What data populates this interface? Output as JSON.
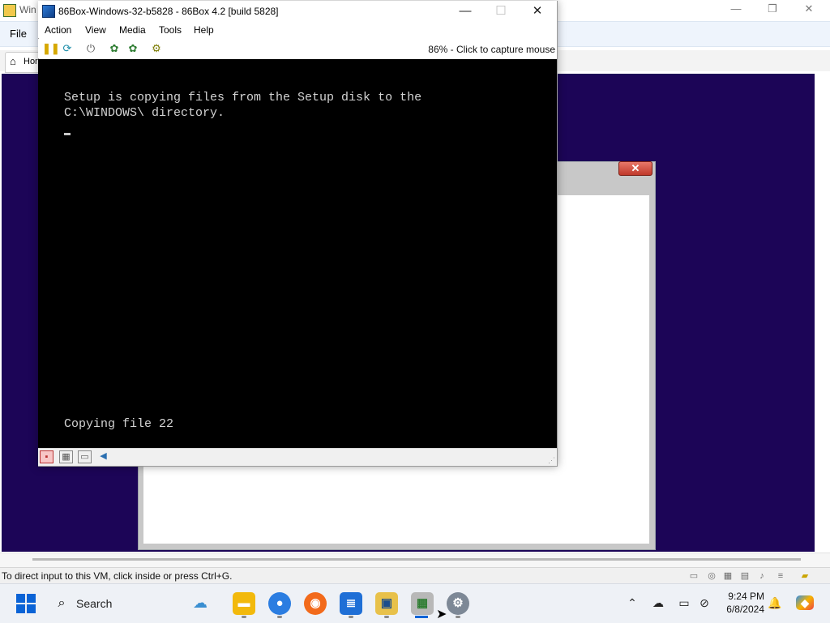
{
  "host": {
    "title": "Win",
    "menu_file": "File",
    "home_tab": "Hor",
    "status_text": "To direct input to this VM, click inside or press Ctrl+G."
  },
  "box": {
    "title": "86Box-Windows-32-b5828 - 86Box 4.2 [build 5828]",
    "menu": [
      "Action",
      "View",
      "Media",
      "Tools",
      "Help"
    ],
    "zoom_status": "86% - Click to capture mouse",
    "screen": {
      "line1": "Setup is copying files from the Setup disk to the",
      "line2": "C:\\WINDOWS\\ directory.",
      "progress": "Copying file 22"
    }
  },
  "vm_dialog": {
    "close": "✕"
  },
  "taskbar": {
    "search_label": "Search",
    "time": "9:24 PM",
    "date": "6/8/2024"
  },
  "icons": {
    "host_app": "vm-app-icon",
    "box_app": "86box-icon",
    "toolbar": [
      "pause-icon",
      "reset-icon",
      "power-icon",
      "ctrl-alt-del-icon",
      "ctrl-alt-esc-icon",
      "settings-icon"
    ],
    "statusbar": [
      "floppy-icon",
      "disk-icon",
      "network-icon",
      "sound-icon"
    ],
    "tray": [
      "chevron-up-icon",
      "onedrive-icon",
      "display-icon",
      "vpn-icon",
      "notification-bell-icon",
      "copilot-icon"
    ]
  },
  "colors": {
    "vm_background": "#1c0557",
    "accent": "#0a63d6",
    "dos_text": "#d3d3d3"
  }
}
